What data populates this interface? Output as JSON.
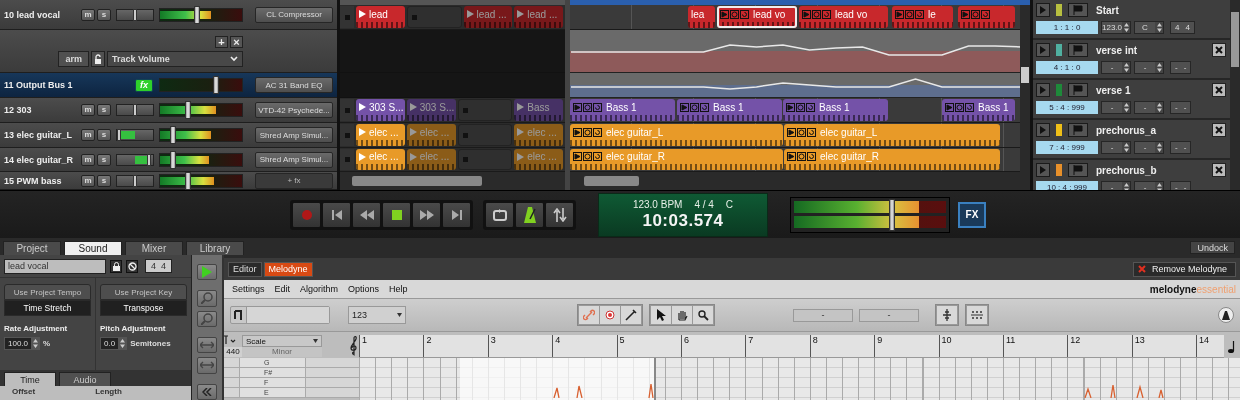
{
  "tracks": [
    {
      "kind": "audio",
      "name": "10 lead vocal",
      "mute": "m",
      "solo": "s",
      "pan": {
        "level": 0.5
      },
      "meter": {
        "level": 0.62
      },
      "fader": {
        "level": 0.45
      },
      "effect": "CL Compressor",
      "selected": false
    },
    {
      "kind": "automation",
      "add": "+",
      "remove": "×",
      "arm": "arm",
      "parameter": "Track Volume",
      "selected": false
    },
    {
      "kind": "bus",
      "name": "11 Output Bus 1",
      "fx": "fx",
      "fader": {
        "level": 0.68
      },
      "effect": "AC 31 Band EQ",
      "selected": true
    },
    {
      "kind": "audio",
      "name": "12 303",
      "mute": "m",
      "solo": "s",
      "pan": {
        "level": 0.5
      },
      "meter": {
        "level": 0.68
      },
      "fader": {
        "level": 0.34
      },
      "effect": "VTD-42 Psychede...",
      "selected": false
    },
    {
      "kind": "audio",
      "name": "13 elec guitar_L",
      "mute": "m",
      "solo": "s",
      "pan": {
        "level": 0.05
      },
      "meter": {
        "level": 0.62
      },
      "fader": {
        "level": 0.17
      },
      "effect": "Shred Amp Simul...",
      "selected": false
    },
    {
      "kind": "audio",
      "name": "14 elec guitar_R",
      "mute": "m",
      "solo": "s",
      "pan": {
        "level": 0.9
      },
      "meter": {
        "level": 0.6
      },
      "fader": {
        "level": 0.17
      },
      "effect": "Shred Amp Simul...",
      "selected": false
    },
    {
      "kind": "audio",
      "name": "15 PWM bass",
      "mute": "m",
      "solo": "s",
      "pan": {
        "level": 0.5
      },
      "meter": {
        "level": 0.66
      },
      "fader": {
        "level": 0.34
      },
      "effect": "+ fx",
      "selected": false
    }
  ],
  "arrangement": {
    "rows": [
      {
        "kind": "clips",
        "color": "#c8282c",
        "slots": [
          {
            "kind": "clip",
            "label": "lead",
            "playing": true
          },
          {
            "kind": "empty"
          },
          {
            "kind": "clip",
            "label": "lead ...",
            "playing": false
          },
          {
            "kind": "clip",
            "label": "lead ...",
            "playing": false
          }
        ],
        "clips": [
          {
            "label": "lea",
            "selected": false
          },
          {
            "label": "lead vo",
            "selected": true
          },
          {
            "label": "lead vo",
            "selected": false
          },
          {
            "label": "le",
            "selected": false
          },
          {
            "selected": false
          }
        ]
      },
      {
        "kind": "lane",
        "color": "#8e5a5a"
      },
      {
        "kind": "lane",
        "color": "#5e6e8e"
      },
      {
        "kind": "clips",
        "color": "#7452a8",
        "slots": [
          {
            "kind": "clip",
            "label": "303 S...",
            "playing": true
          },
          {
            "kind": "clip",
            "label": "303 S...",
            "playing": false
          },
          {
            "kind": "empty"
          },
          {
            "kind": "clip",
            "label": "Bass",
            "playing": false
          }
        ],
        "clips": [
          {
            "label": "Bass 1",
            "selected": false
          },
          {
            "label": "Bass 1",
            "selected": false
          },
          {
            "label": "Bass 1",
            "selected": false
          },
          {
            "label": "Bass 1",
            "selected": false
          }
        ]
      },
      {
        "kind": "clips",
        "color": "#e89a28",
        "slots": [
          {
            "kind": "clip",
            "label": "elec ...",
            "playing": true
          },
          {
            "kind": "clip",
            "label": "elec ...",
            "playing": false
          },
          {
            "kind": "empty"
          },
          {
            "kind": "clip",
            "label": "elec ...",
            "playing": false
          }
        ],
        "clips": [
          {
            "label": "elec guitar_L",
            "selected": false
          },
          {
            "label": "elec guitar_L",
            "selected": false
          }
        ]
      },
      {
        "kind": "clips",
        "color": "#e89a28",
        "slots": [
          {
            "kind": "clip",
            "label": "elec ...",
            "playing": true
          },
          {
            "kind": "clip",
            "label": "elec ...",
            "playing": false
          },
          {
            "kind": "empty"
          },
          {
            "kind": "clip",
            "label": "elec ...",
            "playing": false
          }
        ],
        "clips": [
          {
            "label": "elec guitar_R",
            "selected": false
          },
          {
            "label": "elec guitar_R",
            "selected": false
          }
        ]
      }
    ]
  },
  "markers": [
    {
      "name": "Start",
      "color": "#b8c040",
      "position": "1 : 1 : 0",
      "tempo": "123.0",
      "key": "C",
      "signature": [
        "4",
        "4"
      ],
      "deletable": false
    },
    {
      "name": "verse int",
      "color": "#50b0a0",
      "position": "4 : 1 : 0",
      "tempo": "-",
      "key": "-",
      "signature": [
        "-",
        "-"
      ],
      "deletable": true
    },
    {
      "name": "verse 1",
      "color": "#1e8a3a",
      "position": "5 : 4 : 999",
      "tempo": "-",
      "key": "-",
      "signature": [
        "-",
        "-"
      ],
      "deletable": true
    },
    {
      "name": "prechorus_a",
      "color": "#f0c018",
      "position": "7 : 4 : 999",
      "tempo": "-",
      "key": "-",
      "signature": [
        "-",
        "-"
      ],
      "deletable": true
    },
    {
      "name": "prechorus_b",
      "color": "#e8902a",
      "position": "10 : 4 : 999",
      "tempo": "-",
      "key": "-",
      "signature": [
        "-",
        "-"
      ],
      "deletable": true
    }
  ],
  "transport": {
    "tempo": "123.0 BPM",
    "signature": "4 / 4",
    "key": "C",
    "time": "10:03.574",
    "metronome": true,
    "meter": {
      "level": 0.82
    },
    "fader": {
      "level": 0.62
    },
    "fx": "FX"
  },
  "dock": {
    "tabs": [
      {
        "label": "Project",
        "selected": false
      },
      {
        "label": "Sound",
        "selected": true
      },
      {
        "label": "Mixer",
        "selected": false
      },
      {
        "label": "Library",
        "selected": false
      }
    ],
    "undock": "Undock"
  },
  "inspector": {
    "clip_name": "lead vocal",
    "signature": [
      "4",
      "4"
    ],
    "tempo_button": {
      "label": "Use Project Tempo",
      "disabled": true
    },
    "tempo_mode": "Time Stretch",
    "rate_label": "Rate Adjustment",
    "rate": "100.0",
    "rate_unit": "%",
    "key_button": {
      "label": "Use Project Key",
      "disabled": true
    },
    "key_mode": "Transpose",
    "pitch_label": "Pitch Adjustment",
    "pitch": "0.0",
    "pitch_unit": "Semitones",
    "tabs": [
      {
        "label": "Time",
        "selected": true
      },
      {
        "label": "Audio",
        "selected": false
      }
    ],
    "fields": [
      "Offset",
      "Length"
    ]
  },
  "melodyne": {
    "tabs": [
      {
        "label": "Editor",
        "selected": false
      },
      {
        "label": "Melodyne",
        "selected": true
      }
    ],
    "remove": "Remove Melodyne",
    "menu": [
      "Settings",
      "Edit",
      "Algorithm",
      "Options",
      "Help"
    ],
    "brand": "melodyne",
    "edition": "essential",
    "tempo": "123",
    "fields": [
      "-",
      "-"
    ],
    "scale": "Scale",
    "tuning": "440",
    "mode": "Minor",
    "bars": [
      "1",
      "2",
      "3",
      "4",
      "5",
      "6",
      "7",
      "8",
      "9",
      "10",
      "11",
      "12",
      "13",
      "14"
    ],
    "pitches": [
      {
        "name": "G"
      },
      {
        "name": "F#"
      },
      {
        "name": "F"
      },
      {
        "name": "E"
      }
    ]
  }
}
